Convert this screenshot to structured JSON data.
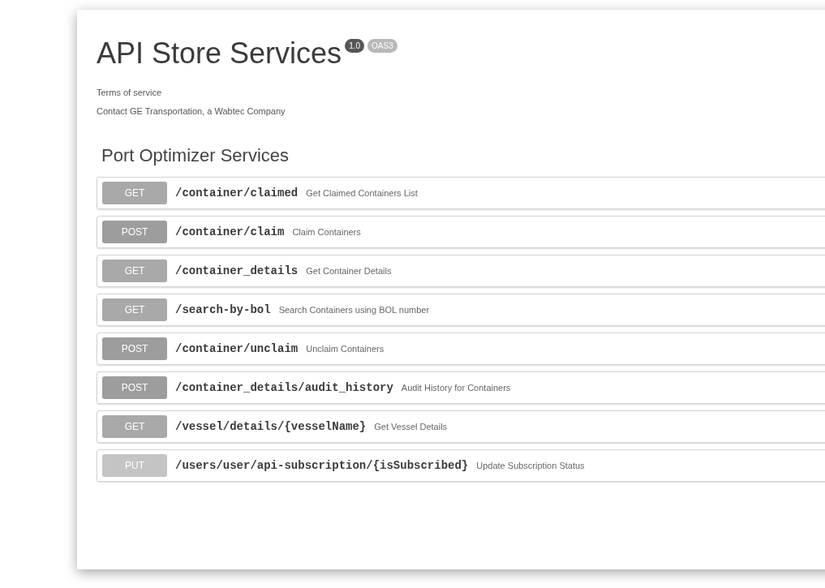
{
  "title": "API Store Services",
  "badges": [
    {
      "text": "1.0",
      "kind": "version"
    },
    {
      "text": "OAS3",
      "kind": "spec"
    }
  ],
  "links": [
    "Terms of service",
    "Contact GE Transportation, a Wabtec Company"
  ],
  "section": {
    "title": "Port Optimizer Services",
    "operations": [
      {
        "method": "GET",
        "kind": "get",
        "path": "/container/claimed",
        "summary": "Get Claimed Containers List"
      },
      {
        "method": "POST",
        "kind": "post",
        "path": "/container/claim",
        "summary": "Claim Containers"
      },
      {
        "method": "GET",
        "kind": "get",
        "path": "/container_details",
        "summary": "Get Container Details"
      },
      {
        "method": "GET",
        "kind": "get",
        "path": "/search-by-bol",
        "summary": "Search Containers using BOL number"
      },
      {
        "method": "POST",
        "kind": "post",
        "path": "/container/unclaim",
        "summary": "Unclaim Containers"
      },
      {
        "method": "POST",
        "kind": "post",
        "path": "/container_details/audit_history",
        "summary": "Audit History for Containers"
      },
      {
        "method": "GET",
        "kind": "get",
        "path": "/vessel/details/{vesselName}",
        "summary": "Get Vessel Details"
      },
      {
        "method": "PUT",
        "kind": "put",
        "path": "/users/user/api-subscription/{isSubscribed}",
        "summary": "Update Subscription Status"
      }
    ]
  }
}
